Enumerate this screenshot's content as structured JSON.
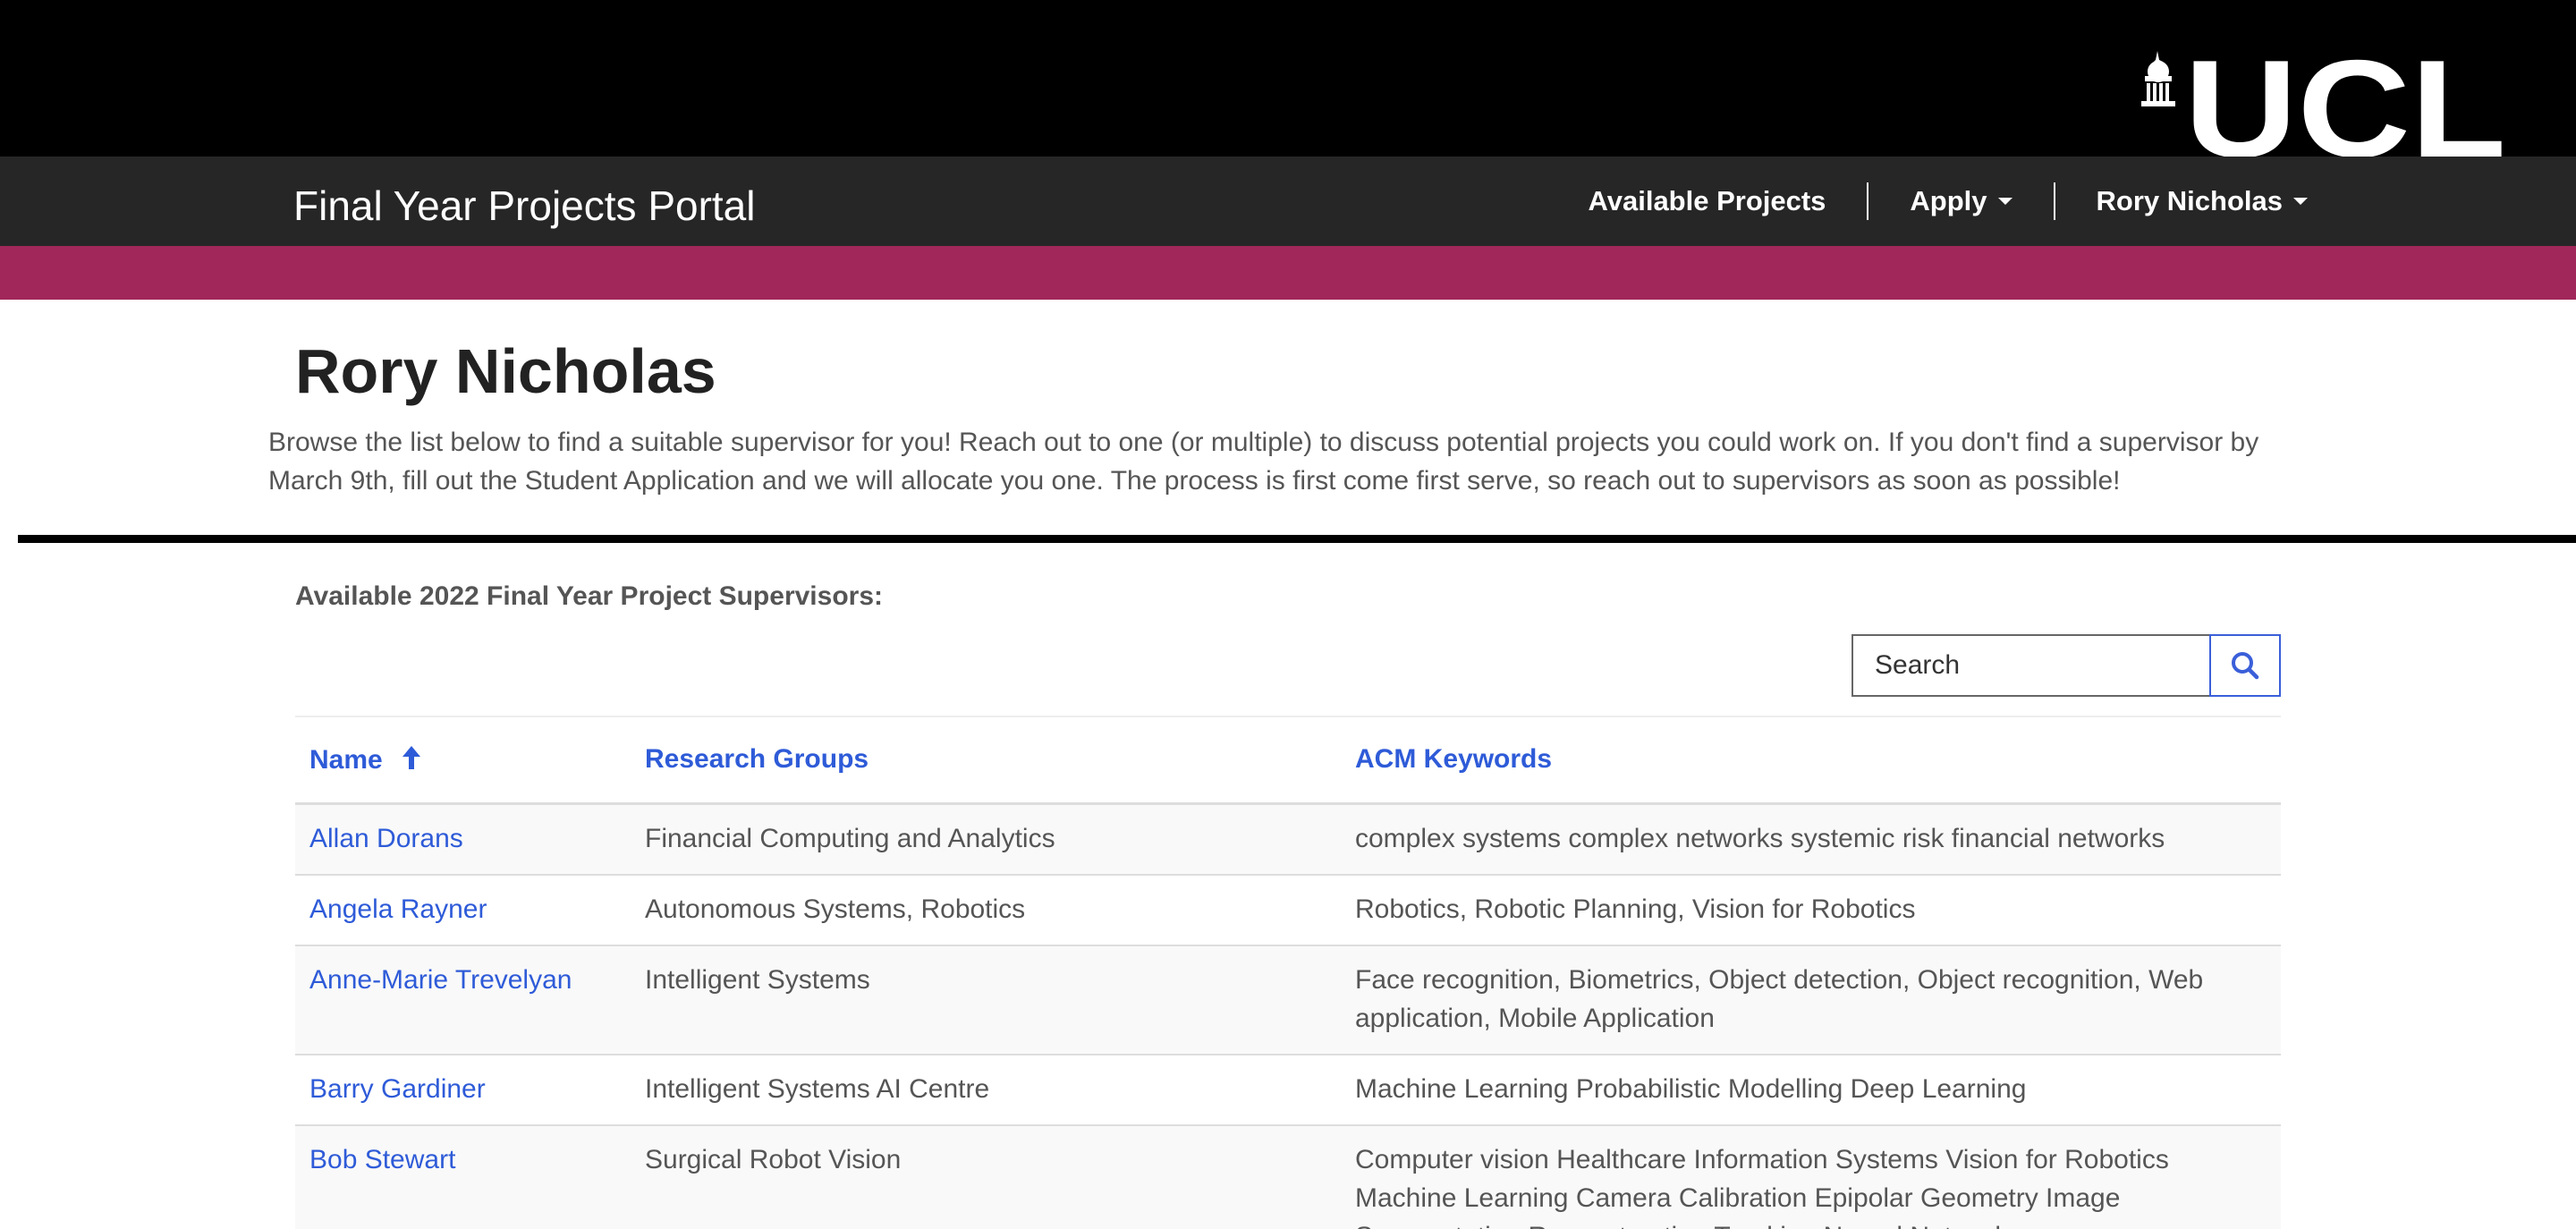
{
  "brand": {
    "logo_text": "UCL",
    "colors": {
      "topbar": "#000000",
      "navbar": "#262626",
      "accent": "#a1275a",
      "link": "#2e5bd8"
    }
  },
  "navbar": {
    "title": "Final Year Projects Portal",
    "items": [
      {
        "label": "Available Projects",
        "has_dropdown": false
      },
      {
        "label": "Apply",
        "has_dropdown": true
      },
      {
        "label": "Rory Nicholas",
        "has_dropdown": true
      }
    ]
  },
  "page": {
    "title": "Rory Nicholas",
    "intro": "Browse the list below to find a suitable supervisor for you! Reach out to one (or multiple) to discuss potential projects you could work on. If you don't find a supervisor by March 9th, fill out the Student Application and we will allocate you one. The process is first come first serve, so reach out to supervisors as soon as possible!",
    "section_label": "Available 2022 Final Year Project Supervisors:"
  },
  "search": {
    "placeholder": "Search",
    "value": "",
    "icon": "search-icon"
  },
  "table": {
    "columns": [
      "Name",
      "Research Groups",
      "ACM Keywords"
    ],
    "sort": {
      "column": "Name",
      "direction": "ascending",
      "icon": "arrow-up-icon"
    },
    "rows": [
      {
        "name": "Allan Dorans",
        "groups": "Financial Computing and Analytics",
        "keywords": "complex systems complex networks systemic risk financial networks"
      },
      {
        "name": "Angela Rayner",
        "groups": "Autonomous Systems, Robotics",
        "keywords": "Robotics, Robotic Planning, Vision for Robotics"
      },
      {
        "name": "Anne-Marie Trevelyan",
        "groups": "Intelligent Systems",
        "keywords": "Face recognition, Biometrics, Object detection, Object recognition, Web application, Mobile Application"
      },
      {
        "name": "Barry Gardiner",
        "groups": "Intelligent Systems AI Centre",
        "keywords": "Machine Learning Probabilistic Modelling Deep Learning"
      },
      {
        "name": "Bob Stewart",
        "groups": "Surgical Robot Vision",
        "keywords": "Computer vision Healthcare Information Systems Vision for Robotics Machine Learning Camera Calibration Epipolar Geometry Image Segmentation Reconstruction Tracking Neural Networks"
      }
    ]
  }
}
